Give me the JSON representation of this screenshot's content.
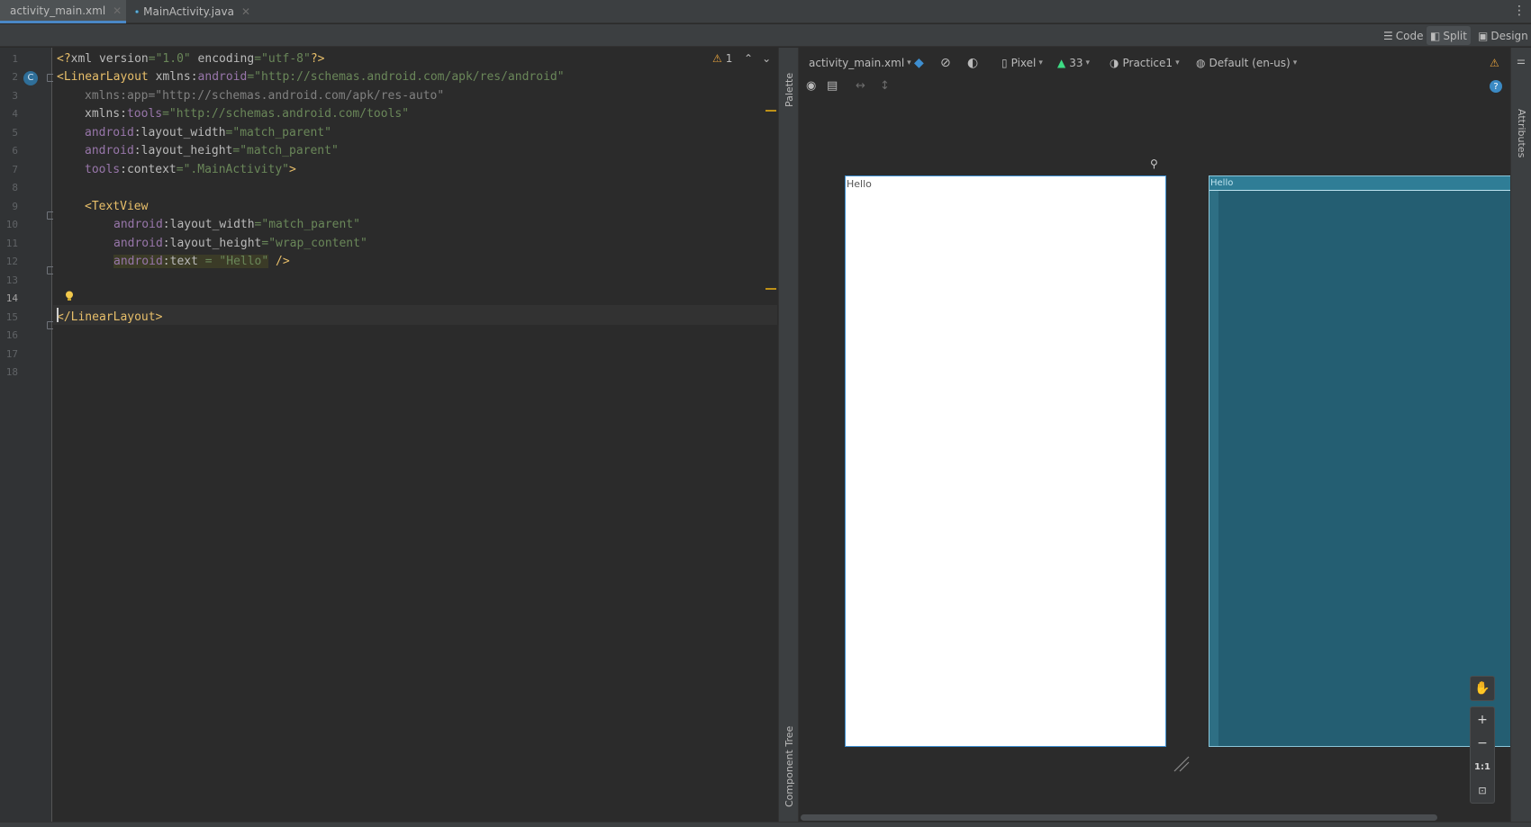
{
  "tabs": [
    {
      "label": "activity_main.xml",
      "icon": "xml-file-icon",
      "active": true
    },
    {
      "label": "MainActivity.java",
      "icon": "java-class-icon",
      "active": false
    }
  ],
  "view_modes": {
    "code": "Code",
    "split": "Split",
    "design": "Design",
    "selected": "Split"
  },
  "editor": {
    "line_numbers": [
      "1",
      "2",
      "3",
      "4",
      "5",
      "6",
      "7",
      "8",
      "9",
      "10",
      "11",
      "12",
      "13",
      "14",
      "15",
      "16",
      "17",
      "18"
    ],
    "current_line": "14",
    "gutter_class_badge": "C",
    "warnings_count": "1",
    "code": {
      "l1_open": "<?",
      "l1_xml": "xml ",
      "l1_version_attr": "version",
      "l1_version_val": "=\"1.0\"",
      "l1_encoding_attr": " encoding",
      "l1_encoding_val": "=\"utf-8\"",
      "l1_close": "?>",
      "l2_tag": "<LinearLayout",
      "l2_attr": " xmlns:",
      "l2_ns": "android",
      "l2_val": "=\"http://schemas.android.com/apk/res/android\"",
      "l3_attr": "xmlns:app",
      "l3_val": "=\"http://schemas.android.com/apk/res-auto\"",
      "l4_attr": "xmlns:",
      "l4_ns": "tools",
      "l4_val": "=\"http://schemas.android.com/tools\"",
      "l5_ns": "android",
      "l5_attr": ":layout_width",
      "l5_val": "=\"match_parent\"",
      "l6_ns": "android",
      "l6_attr": ":layout_height",
      "l6_val": "=\"match_parent\"",
      "l7_ns": "tools",
      "l7_attr": ":context",
      "l7_val": "=\".MainActivity\"",
      "l7_close": ">",
      "l9_tag": "<TextView",
      "l10_ns": "android",
      "l10_attr": ":layout_width",
      "l10_val": "=\"match_parent\"",
      "l11_ns": "android",
      "l11_attr": ":layout_height",
      "l11_val": "=\"wrap_content\"",
      "l12_ns": "android",
      "l12_attr": ":text",
      "l12_val": " = \"Hello\"",
      "l12_close": " />",
      "l15_tag": "</LinearLayout>"
    }
  },
  "side_panels": {
    "palette": "Palette",
    "component_tree": "Component Tree",
    "attributes": "Attributes"
  },
  "design_toolbar": {
    "file": "activity_main.xml",
    "device": "Pixel",
    "api_level": "33",
    "theme": "Practice1",
    "locale": "Default (en-us)"
  },
  "preview": {
    "design_text": "Hello",
    "blueprint_text": "Hello"
  },
  "zoom_controls": {
    "one_to_one": "1:1"
  },
  "colors": {
    "accent": "#4a88c7",
    "warning": "#e6a23c",
    "blueprint": "#245e72"
  }
}
